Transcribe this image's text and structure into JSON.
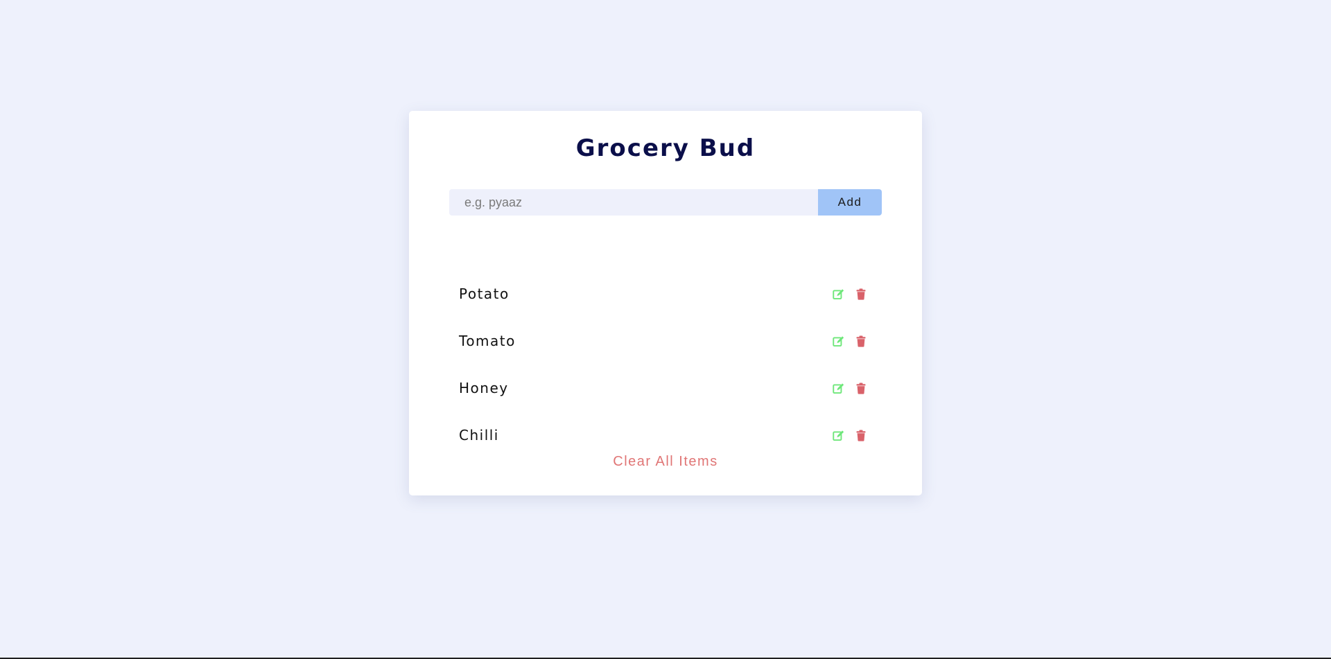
{
  "app": {
    "title": "Grocery Bud"
  },
  "form": {
    "input_placeholder": "e.g. pyaaz",
    "input_value": "",
    "add_label": "Add"
  },
  "items": [
    {
      "name": "Potato",
      "edit_icon": "edit-icon",
      "delete_icon": "trash-icon"
    },
    {
      "name": "Tomato",
      "edit_icon": "edit-icon",
      "delete_icon": "trash-icon"
    },
    {
      "name": "Honey",
      "edit_icon": "edit-icon",
      "delete_icon": "trash-icon"
    },
    {
      "name": "Chilli",
      "edit_icon": "edit-icon",
      "delete_icon": "trash-icon"
    }
  ],
  "footer": {
    "clear_label": "Clear All Items"
  },
  "colors": {
    "background": "#eef1fc",
    "title": "#0b0f4a",
    "add_button": "#a0c4f7",
    "edit_icon": "#6ee77a",
    "delete_icon": "#d9626a",
    "clear_text": "#e07575"
  }
}
